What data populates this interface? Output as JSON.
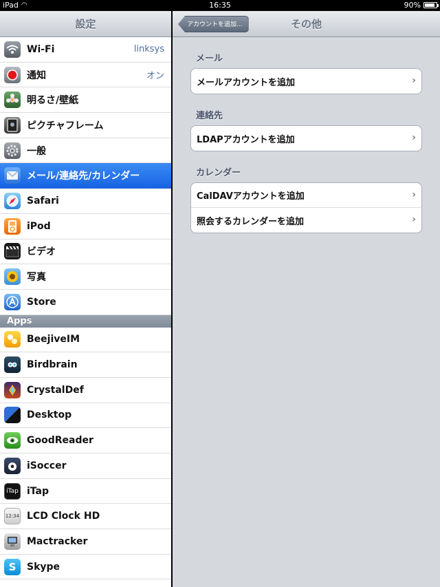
{
  "status": {
    "device": "iPad",
    "time": "16:35",
    "battery": "90%",
    "battery_level": 0.9
  },
  "left": {
    "title": "設定",
    "items": [
      {
        "name": "wifi",
        "label": "Wi-Fi",
        "value": "linksys",
        "icon": "wifi-icon"
      },
      {
        "name": "notifications",
        "label": "通知",
        "value": "オン",
        "icon": "notifications-icon"
      },
      {
        "name": "brightness",
        "label": "明るさ/壁紙",
        "value": "",
        "icon": "flower-icon"
      },
      {
        "name": "picture-frame",
        "label": "ピクチャフレーム",
        "value": "",
        "icon": "picture-frame-icon"
      },
      {
        "name": "general",
        "label": "一般",
        "value": "",
        "icon": "gear-icon"
      },
      {
        "name": "mail",
        "label": "メール/連絡先/カレンダー",
        "value": "",
        "icon": "envelope-icon",
        "selected": true
      },
      {
        "name": "safari",
        "label": "Safari",
        "value": "",
        "icon": "compass-icon"
      },
      {
        "name": "ipod",
        "label": "iPod",
        "value": "",
        "icon": "ipod-icon"
      },
      {
        "name": "video",
        "label": "ビデオ",
        "value": "",
        "icon": "clapper-icon"
      },
      {
        "name": "photos",
        "label": "写真",
        "value": "",
        "icon": "sunflower-icon"
      },
      {
        "name": "store",
        "label": "Store",
        "value": "",
        "icon": "app-store-icon"
      }
    ],
    "apps_header": "Apps",
    "apps": [
      {
        "name": "beejiveim",
        "label": "BeejiveIM",
        "icon": "beejive-icon"
      },
      {
        "name": "birdbrain",
        "label": "Birdbrain",
        "icon": "bird-icon"
      },
      {
        "name": "crystaldef",
        "label": "CrystalDef",
        "icon": "crystal-icon"
      },
      {
        "name": "desktop",
        "label": "Desktop",
        "icon": "desktop-icon"
      },
      {
        "name": "goodreader",
        "label": "GoodReader",
        "icon": "eye-icon"
      },
      {
        "name": "isoccer",
        "label": "iSoccer",
        "icon": "soccer-icon"
      },
      {
        "name": "itap",
        "label": "iTap",
        "icon": "itap-icon",
        "icon_text": "iTap"
      },
      {
        "name": "lcd-clock",
        "label": "LCD Clock HD",
        "icon": "clock-icon",
        "icon_text": "12:34"
      },
      {
        "name": "mactracker",
        "label": "Mactracker",
        "icon": "mac-icon"
      },
      {
        "name": "skype",
        "label": "Skype",
        "icon": "skype-icon",
        "icon_text": "S"
      }
    ]
  },
  "right": {
    "back_label": "アカウントを追加...",
    "title": "その他",
    "groups": [
      {
        "label": "メール",
        "cells": [
          "メールアカウントを追加"
        ]
      },
      {
        "label": "連絡先",
        "cells": [
          "LDAPアカウントを追加"
        ]
      },
      {
        "label": "カレンダー",
        "cells": [
          "CalDAVアカウントを追加",
          "照会するカレンダーを追加"
        ]
      }
    ]
  }
}
